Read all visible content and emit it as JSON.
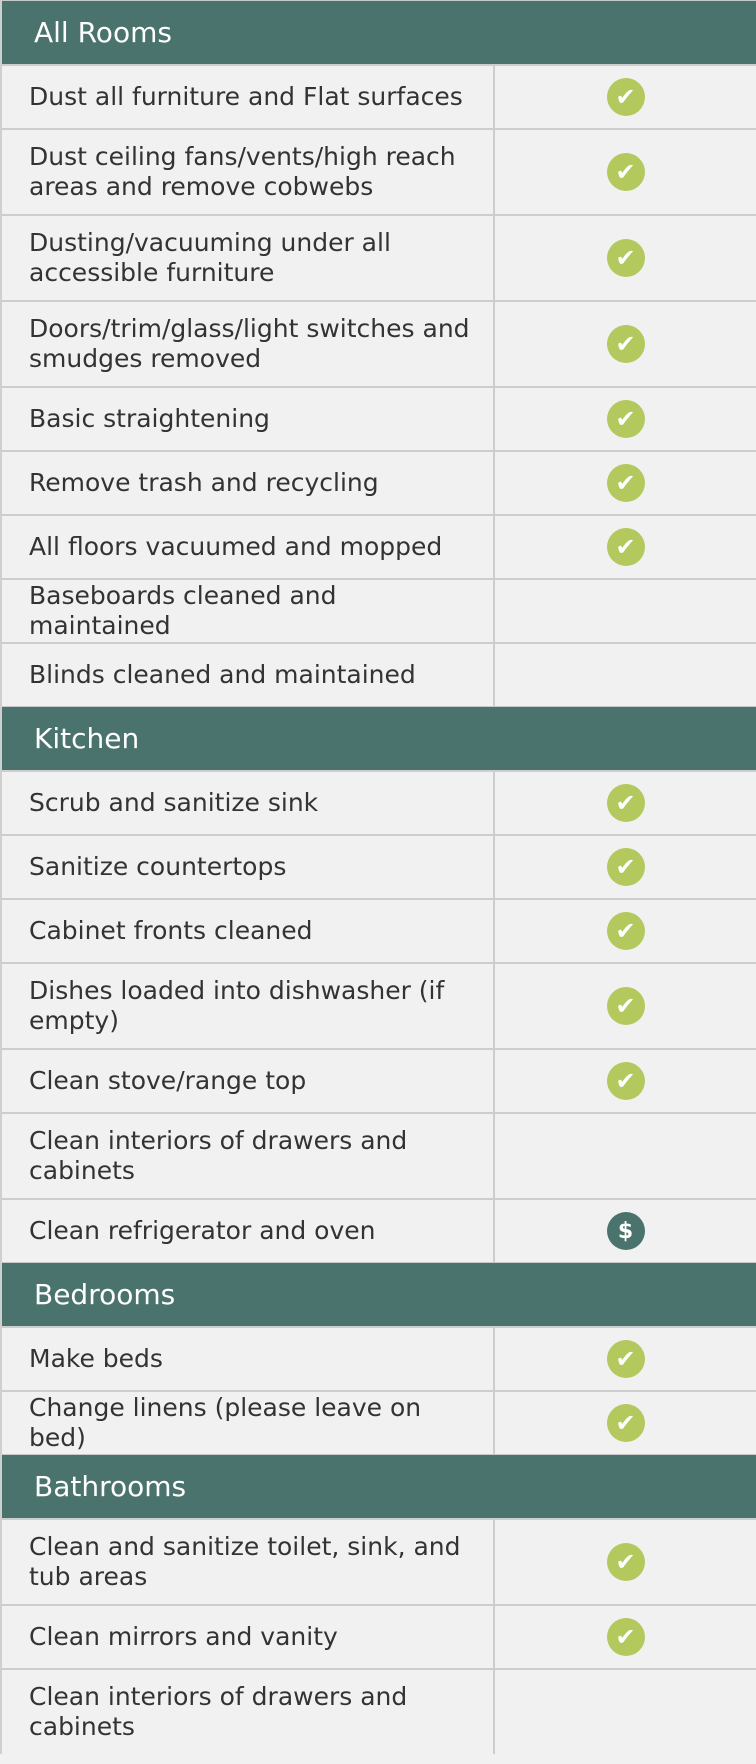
{
  "sections": [
    {
      "title": "All Rooms",
      "rows": [
        {
          "label": "Dust all furniture and Flat surfaces",
          "status": "check"
        },
        {
          "label": "Dust ceiling fans/vents/high reach areas and remove cobwebs",
          "status": "check"
        },
        {
          "label": "Dusting/vacuuming under all accessible furniture",
          "status": "check"
        },
        {
          "label": "Doors/trim/glass/light switches and smudges removed",
          "status": "check"
        },
        {
          "label": "Basic straightening",
          "status": "check"
        },
        {
          "label": "Remove trash and recycling",
          "status": "check"
        },
        {
          "label": "All floors vacuumed and mopped",
          "status": "check"
        },
        {
          "label": "Baseboards cleaned and maintained",
          "status": ""
        },
        {
          "label": "Blinds cleaned and maintained",
          "status": ""
        }
      ]
    },
    {
      "title": "Kitchen",
      "rows": [
        {
          "label": "Scrub and sanitize sink",
          "status": "check"
        },
        {
          "label": "Sanitize countertops",
          "status": "check"
        },
        {
          "label": "Cabinet fronts cleaned",
          "status": "check"
        },
        {
          "label": "Dishes loaded into dishwasher (if empty)",
          "status": "check"
        },
        {
          "label": "Clean stove/range top",
          "status": "check"
        },
        {
          "label": "Clean interiors of drawers and cabinets",
          "status": ""
        },
        {
          "label": "Clean refrigerator and oven",
          "status": "dollar"
        }
      ]
    },
    {
      "title": "Bedrooms",
      "rows": [
        {
          "label": "Make beds",
          "status": "check"
        },
        {
          "label": "Change linens (please leave on bed)",
          "status": "check"
        }
      ]
    },
    {
      "title": "Bathrooms",
      "rows": [
        {
          "label": "Clean and sanitize toilet, sink, and tub areas",
          "status": "check"
        },
        {
          "label": "Clean mirrors and vanity",
          "status": "check"
        },
        {
          "label": "Clean interiors of drawers and cabinets",
          "status": ""
        }
      ]
    }
  ],
  "icons": {
    "check": {
      "glyph": "✔",
      "name": "check-circle-icon",
      "color": "#b3c85d"
    },
    "dollar": {
      "glyph": "$",
      "name": "dollar-circle-icon",
      "color": "#4a736d"
    }
  },
  "colors": {
    "header_bg": "#4a736d",
    "row_bg": "#f1f1f1"
  }
}
